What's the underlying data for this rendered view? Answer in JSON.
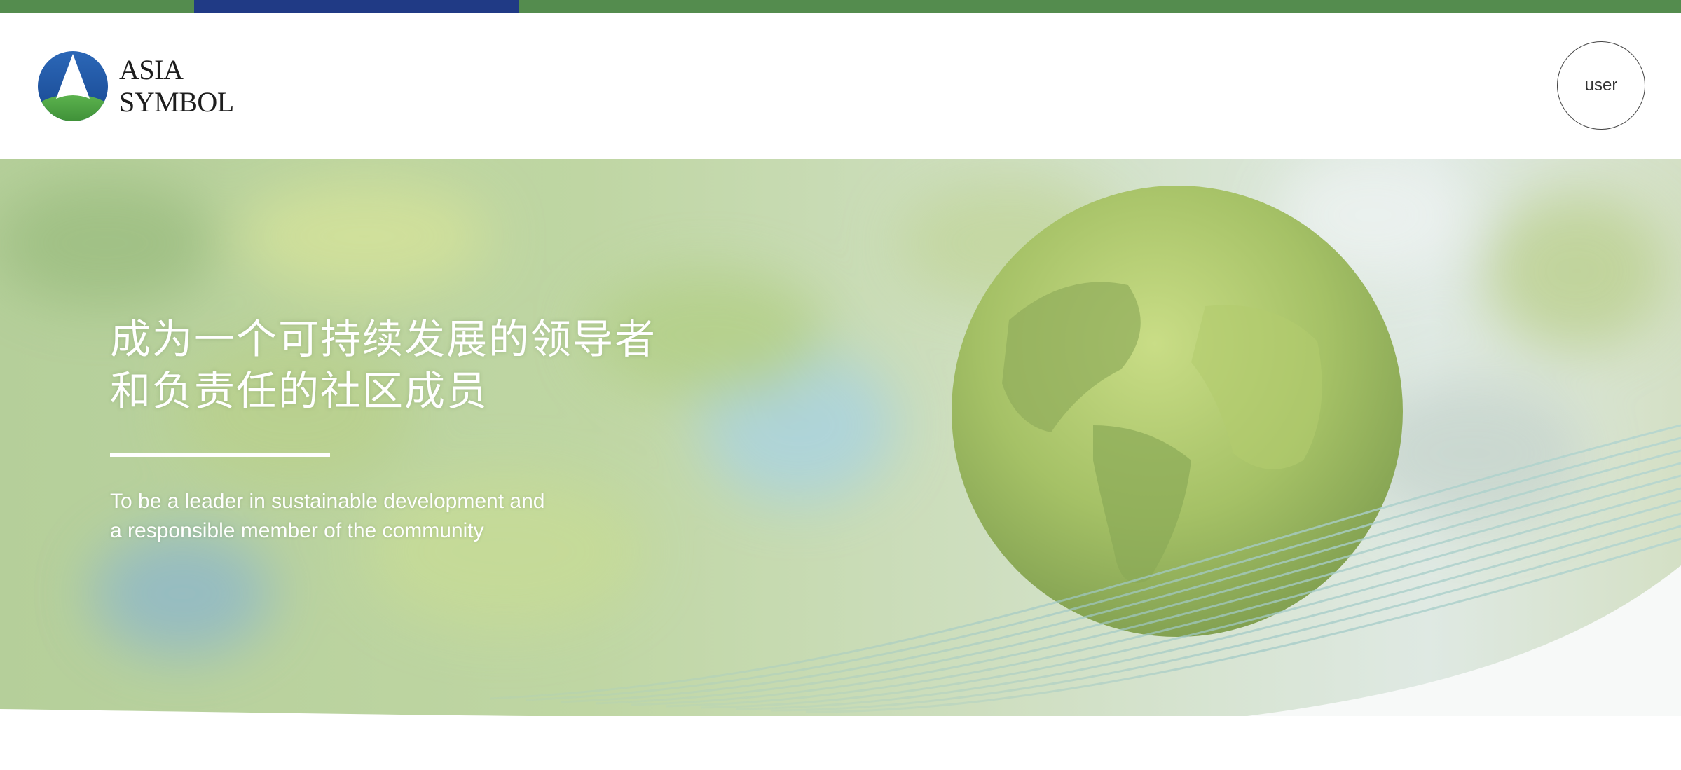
{
  "brand": {
    "name_line1": "ASIA",
    "name_line2": "SYMBOL",
    "colors": {
      "green": "#548c4e",
      "navy": "#203a85",
      "logo_blue": "#1f56a6",
      "logo_green": "#3f9a3c"
    }
  },
  "header": {
    "user_label": "user"
  },
  "hero": {
    "title_line1": "成为一个可持续发展的领导者",
    "title_line2": "和负责任的社区成员",
    "subtitle_line1": "To be a leader in sustainable development and",
    "subtitle_line2": "a responsible member of the community",
    "image_subject": "grass-covered-globe"
  }
}
